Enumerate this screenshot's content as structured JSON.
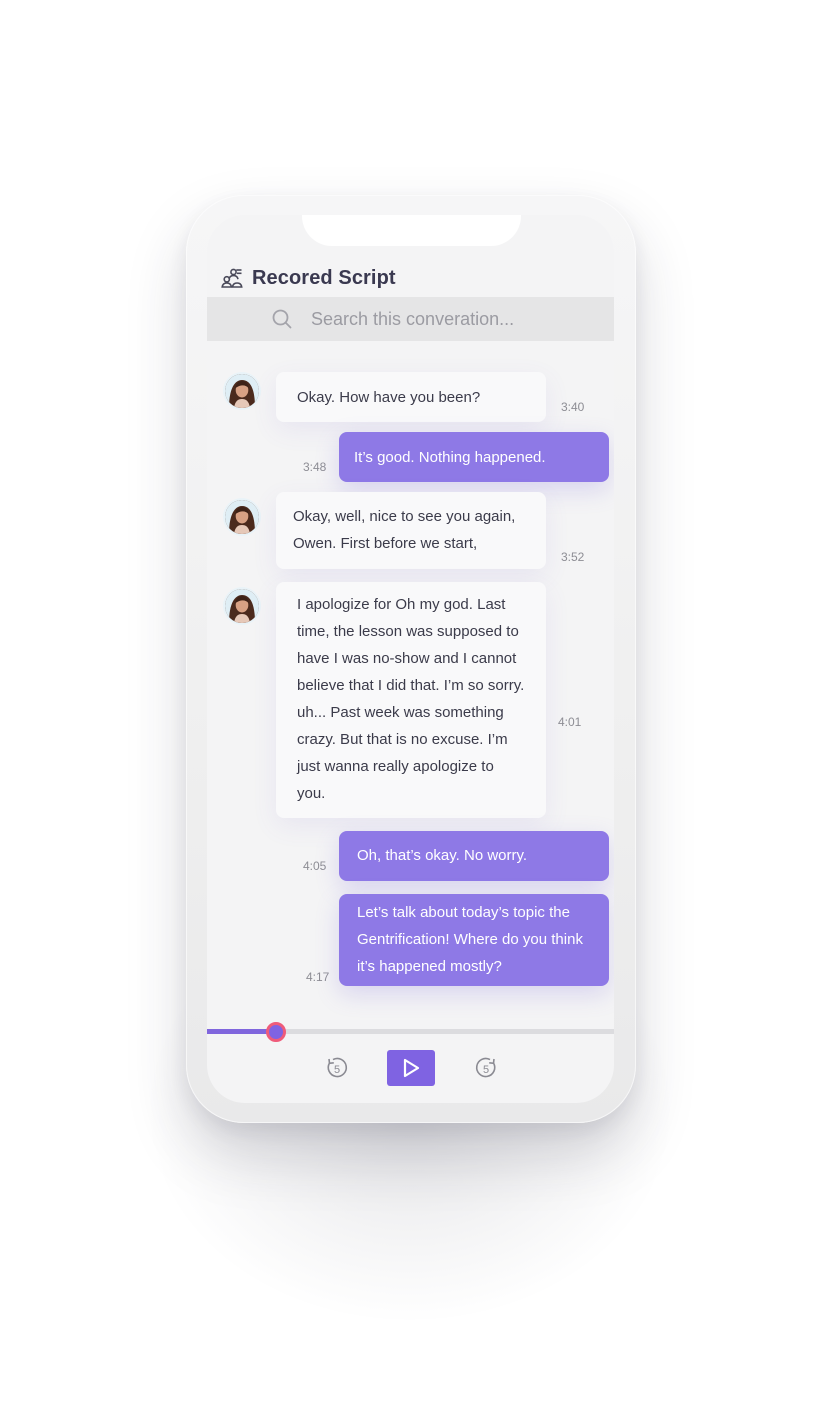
{
  "header": {
    "title": "Recored Script",
    "icon": "people-list-icon"
  },
  "search": {
    "placeholder": "Search this converation...",
    "value": ""
  },
  "messages": [
    {
      "side": "in",
      "text": "Okay. How have you been?",
      "time": "3:40",
      "avatar": true
    },
    {
      "side": "out",
      "text": "It’s good. Nothing happened.",
      "time": "3:48"
    },
    {
      "side": "in",
      "text": "Okay, well, nice to see you again, Owen. First before we start,",
      "time": "3:52",
      "avatar": true
    },
    {
      "side": "in",
      "text": "I apologize for Oh my god. Last time, the lesson was supposed to have I was no-show and I cannot believe that I did that. I’m so sorry. uh... Past week was something crazy. But that is no excuse. I’m just wanna really apologize to you.",
      "time": "4:01",
      "avatar": true
    },
    {
      "side": "out",
      "text": "Oh, that’s okay. No worry.",
      "time": "4:05"
    },
    {
      "side": "out",
      "text": "Let’s talk about today’s topic the Gentrification! Where do you think it’s happened mostly?",
      "time": "4:17"
    }
  ],
  "player": {
    "progress": 0.17,
    "rewind_icon": "rewind-5-icon",
    "rewind_label": "5",
    "play_icon": "play-icon",
    "forward_icon": "forward-5-icon",
    "forward_label": "5"
  },
  "colors": {
    "accent": "#7f63e2",
    "outgoing_bubble": "#8e79e6",
    "incoming_bubble": "#f9f9fa",
    "progress_thumb_ring": "#ef5b7a"
  }
}
